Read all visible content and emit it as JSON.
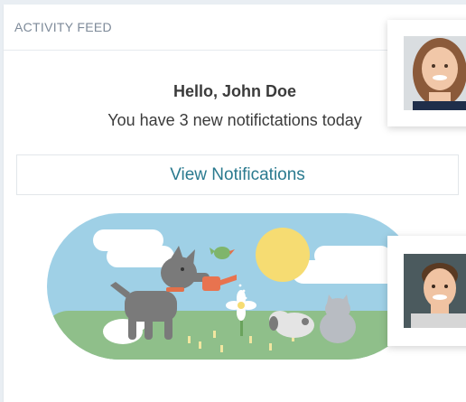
{
  "feed": {
    "title": "ACTIVITY FEED",
    "greeting": "Hello, John Doe",
    "subtext": "You have 3 new notifictations today",
    "button_label": "View Notifications"
  },
  "colors": {
    "accent": "#2a7a8f",
    "header_text": "#7d8a99",
    "background": "#e9eef3",
    "illustration_sky": "#9fd0e6",
    "illustration_grass": "#8fbf8a",
    "sun": "#f6dc72"
  },
  "avatars": [
    {
      "name": "female-avatar"
    },
    {
      "name": "male-avatar"
    }
  ]
}
